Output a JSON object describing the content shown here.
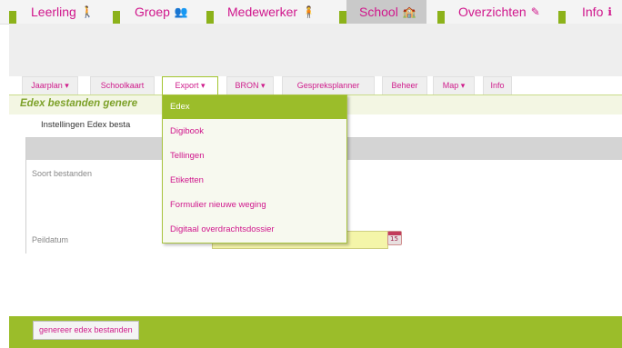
{
  "top_nav": {
    "tabs": [
      {
        "label": "Leerling",
        "icon": "student-icon",
        "glyph": "🚶"
      },
      {
        "label": "Groep",
        "icon": "group-icon",
        "glyph": "👥"
      },
      {
        "label": "Medewerker",
        "icon": "staff-icon",
        "glyph": "🧍"
      },
      {
        "label": "School",
        "icon": "school-icon",
        "glyph": "🏫"
      },
      {
        "label": "Overzichten",
        "icon": "pen-icon",
        "glyph": "✎"
      },
      {
        "label": "Info",
        "icon": "info-icon",
        "glyph": "ℹ"
      }
    ],
    "active_tab": "School"
  },
  "sub_nav": {
    "items": [
      "Jaarplan ▾",
      "Schoolkaart",
      "Export ▾",
      "BRON ▾",
      "Gespreksplanner",
      "Beheer",
      "Map ▾",
      "Info"
    ],
    "open_item": "Export ▾"
  },
  "page": {
    "title": "Edex bestanden genere",
    "subtitle": "Instellingen Edex besta",
    "fields": {
      "soort_label": "Soort bestanden",
      "peildatum_label": "Peildatum",
      "peildatum_value": ""
    },
    "calendar_icon_text": "15"
  },
  "dropdown": {
    "items": [
      "Edex",
      "Digibook",
      "Tellingen",
      "Etiketten",
      "Formulier nieuwe weging",
      "Digitaal overdrachtsdossier"
    ],
    "highlighted": "Edex"
  },
  "footer": {
    "generate_button": "genereer edex bestanden"
  },
  "colors": {
    "accent_green": "#9bbd2a",
    "brand_magenta": "#d0168c",
    "date_field": "#f4f5a9"
  }
}
